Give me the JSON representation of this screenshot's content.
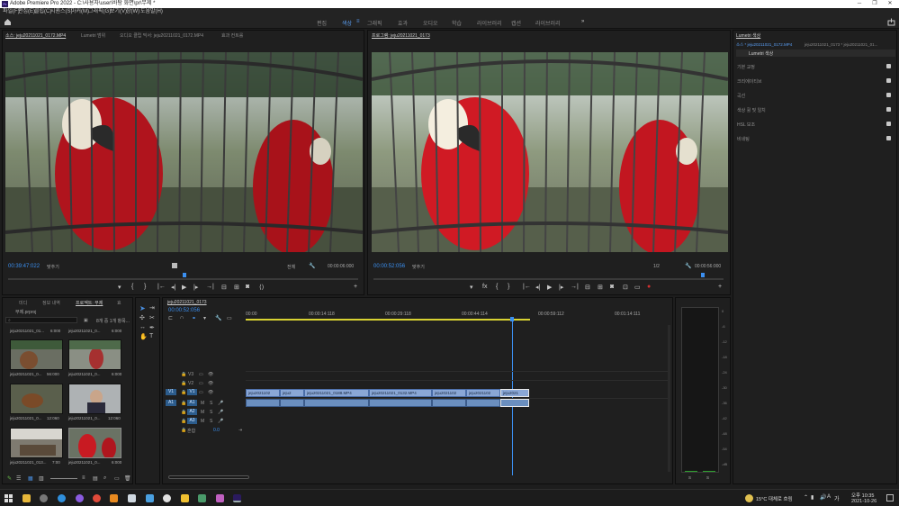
{
  "window": {
    "title": "Adobe Premiere Pro 2022 - C:\\사용자\\user\\바탕 화면\\pr\\무제 *",
    "min": "─",
    "max": "❐",
    "close": "✕"
  },
  "menu": [
    "파일(F)",
    "편집(E)",
    "클립(C)",
    "시퀀스(S)",
    "마커(M)",
    "그래픽(G)",
    "보기(V)",
    "창(W)",
    "도움말(H)"
  ],
  "workspaces": [
    "편집",
    "색상",
    "그래픽",
    "효과",
    "오디오",
    "학습",
    "라이브러리",
    "캡션",
    "라이브러리"
  ],
  "workspace_active_index": 1,
  "workspace_more": "»",
  "source_monitor": {
    "tabs": [
      "소스: jeju20211021_0172.MP4",
      "Lumetri 범위",
      "오디오 클립 믹서: jeju20211021_0172.MP4",
      "효과 컨트롤"
    ],
    "timecode": "00:39:47:022",
    "fit": "맞추기",
    "quality": "전체",
    "duration": "00:00:06:000"
  },
  "program_monitor": {
    "tab": "프로그램: jeju20211021_0173",
    "timecode": "00:00:52:056",
    "fit": "맞추기",
    "quality": "1/2",
    "duration": "00:00:56:000"
  },
  "lumetri": {
    "tabs": [
      "Lumetri 색상"
    ],
    "source_tabs": [
      "소스 * jeju20211021_0172.MP4",
      "jeju20211021_0173 * jeju20211021_01..."
    ],
    "effect": "Lumetri 색상",
    "sections": [
      "기본 교정",
      "크리에이티브",
      "곡선",
      "색상 휠 및 일치",
      "HSL 보조",
      "비네팅"
    ]
  },
  "project": {
    "tabs": [
      "미디",
      "정보 내역",
      "프로젝트: 무제",
      "효"
    ],
    "name": "무제.prproj",
    "count": "8개 중 1개 항목...",
    "items": [
      {
        "label": "jeju20211021_01...",
        "duration": "6:000"
      },
      {
        "label": "jeju20211021_0...",
        "duration": "6:000"
      },
      {
        "label": "jeju20211021_0...",
        "duration": "56:000"
      },
      {
        "label": "jeju20211021_0...",
        "duration": "6:000"
      },
      {
        "label": "jeju20211021_0...",
        "duration": "12:060"
      },
      {
        "label": "jeju20211021_0...",
        "duration": "12:060"
      },
      {
        "label": "jeju20211021_013...",
        "duration": "7:00"
      },
      {
        "label": "jeju20211021_0...",
        "duration": "6:000"
      }
    ]
  },
  "timeline": {
    "tab": "jeju20211021_0173",
    "timecode": "00:00:52:056",
    "ruler": [
      "00:00",
      "00:00:14:118",
      "00:00:29:118",
      "00:00:44:114",
      "00:00:59:112",
      "00:01:14:111"
    ],
    "tracks_video": [
      "V3",
      "V2",
      "V1"
    ],
    "tracks_audio": [
      "A1",
      "A2",
      "A3"
    ],
    "source_v": "V1",
    "source_a": "A1",
    "master": "혼합",
    "master_value": "0.0",
    "clips": [
      "jeju2021102",
      "jeju2",
      "jeju20211021_0188.MP4",
      "jeju20211021_0132.MP4",
      "jeju2021102",
      "jeju2021102",
      "jeju2021"
    ],
    "audio_ticks": [
      "0",
      "-6",
      "-12",
      "-18",
      "-24",
      "-30",
      "-36",
      "-42",
      "-48",
      "-54",
      "-dB"
    ],
    "meter_labels": [
      "S",
      "S"
    ]
  },
  "taskbar": {
    "weather": "15°C 대체로 흐림",
    "lang": "A",
    "ime": "가",
    "time": "오후 10:35",
    "date": "2021-10-26"
  }
}
